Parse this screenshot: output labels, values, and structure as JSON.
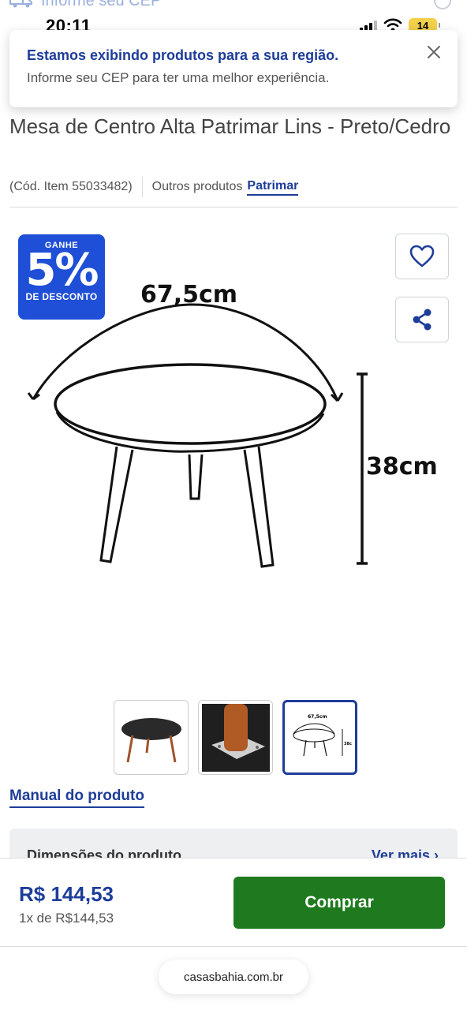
{
  "header": {
    "cep_prompt": "Informe seu CEP"
  },
  "status_bar": {
    "time": "20:11",
    "battery": "14"
  },
  "toast": {
    "title": "Estamos exibindo produtos para a sua região.",
    "subtitle": "Informe seu CEP para ter uma melhor experiência."
  },
  "product": {
    "title": "Mesa de Centro Alta Patrimar Lins - Preto/Cedro",
    "code": "(Cód. Item 55033482)",
    "others_label": "Outros produtos",
    "brand": "Patrimar"
  },
  "badge": {
    "line1": "GANHE",
    "percent": "5%",
    "line2": "DE DESCONTO"
  },
  "image": {
    "width_label": "67,5cm",
    "height_label": "38cm"
  },
  "thumbnails": [
    {
      "name": "thumb-table-photo",
      "active": false
    },
    {
      "name": "thumb-leg-detail",
      "active": false
    },
    {
      "name": "thumb-dimensions-drawing",
      "active": true
    }
  ],
  "links": {
    "manual": "Manual do produto"
  },
  "dimensions_card": {
    "title": "Dimensões do produto",
    "link": "Ver mais"
  },
  "purchase": {
    "price": "R$ 144,53",
    "installment": "1x de R$144,53",
    "buy_label": "Comprar"
  },
  "browser": {
    "url": "casasbahia.com.br"
  },
  "colors": {
    "brand_blue": "#1e3d99",
    "badge_blue": "#1f4fd6",
    "buy_green": "#1f7a1f",
    "battery_yellow": "#f3d04a"
  }
}
